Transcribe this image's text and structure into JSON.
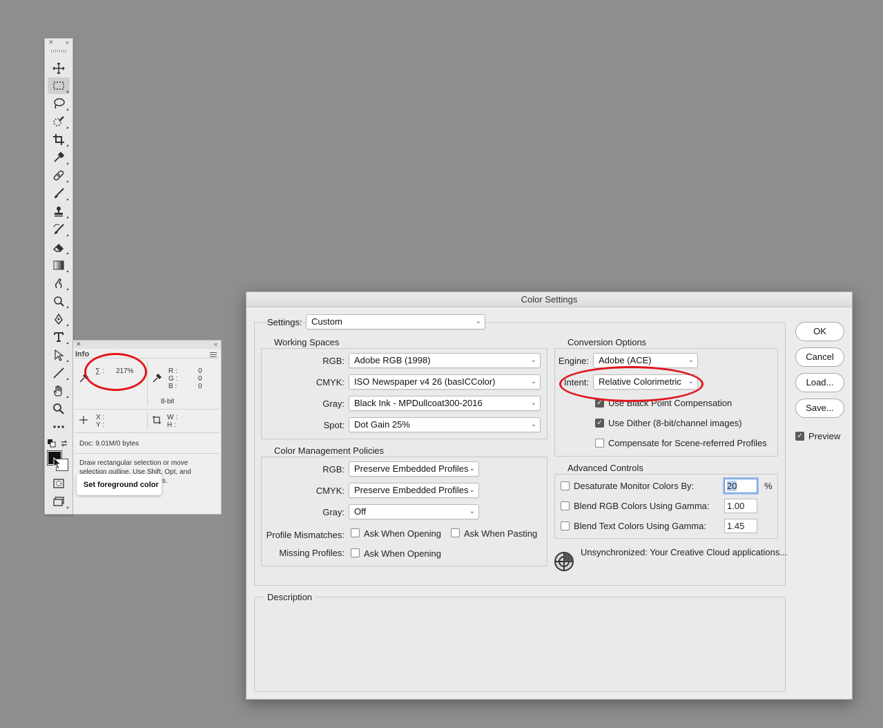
{
  "info_panel": {
    "tab": "Info",
    "sigma_label": "∑ :",
    "sigma_value": "217%",
    "r_label": "R :",
    "r_value": "0",
    "g_label": "G :",
    "g_value": "0",
    "b_label": "B :",
    "b_value": "0",
    "bit_depth": "8-bit",
    "x_label": "X :",
    "y_label": "Y :",
    "w_label": "W :",
    "h_label": "H :",
    "doc": "Doc: 9.01M/0 bytes",
    "hint_line1": "Draw rectangular selection or move",
    "hint_line2": "selection outline.  Use Shift, Opt, and",
    "hint_line3": "s."
  },
  "tooltip": {
    "text": "Set foreground color"
  },
  "dialog": {
    "title": "Color Settings",
    "settings_label": "Settings:",
    "settings_value": "Custom",
    "working_spaces": {
      "title": "Working Spaces",
      "rgb_label": "RGB:",
      "rgb_value": "Adobe RGB (1998)",
      "cmyk_label": "CMYK:",
      "cmyk_value": "ISO Newspaper v4 26 (basICColor)",
      "gray_label": "Gray:",
      "gray_value": "Black Ink - MPDullcoat300-2016",
      "spot_label": "Spot:",
      "spot_value": "Dot Gain 25%"
    },
    "policies": {
      "title": "Color Management Policies",
      "rgb_label": "RGB:",
      "rgb_value": "Preserve Embedded Profiles",
      "cmyk_label": "CMYK:",
      "cmyk_value": "Preserve Embedded Profiles",
      "gray_label": "Gray:",
      "gray_value": "Off",
      "mismatch_label": "Profile Mismatches:",
      "ask_opening": "Ask When Opening",
      "ask_pasting": "Ask When Pasting",
      "missing_label": "Missing Profiles:",
      "missing_ask_opening": "Ask When Opening"
    },
    "conversion": {
      "title": "Conversion Options",
      "engine_label": "Engine:",
      "engine_value": "Adobe (ACE)",
      "intent_label": "Intent:",
      "intent_value": "Relative Colorimetric",
      "black_point": "Use Black Point Compensation",
      "dither": "Use Dither (8-bit/channel images)",
      "scene_referred": "Compensate for Scene-referred Profiles"
    },
    "advanced": {
      "title": "Advanced Controls",
      "desaturate_label": "Desaturate Monitor Colors By:",
      "desaturate_value": "20",
      "percent": "%",
      "blend_rgb_label": "Blend RGB Colors Using Gamma:",
      "blend_rgb_value": "1.00",
      "blend_text_label": "Blend Text Colors Using Gamma:",
      "blend_text_value": "1.45"
    },
    "sync_status": "Unsynchronized: Your Creative Cloud applications...",
    "description_title": "Description",
    "buttons": {
      "ok": "OK",
      "cancel": "Cancel",
      "load": "Load...",
      "save": "Save..."
    },
    "preview_label": "Preview"
  },
  "colors": {
    "annotation_red": "#e2161c",
    "background": "#8e8e8e"
  }
}
